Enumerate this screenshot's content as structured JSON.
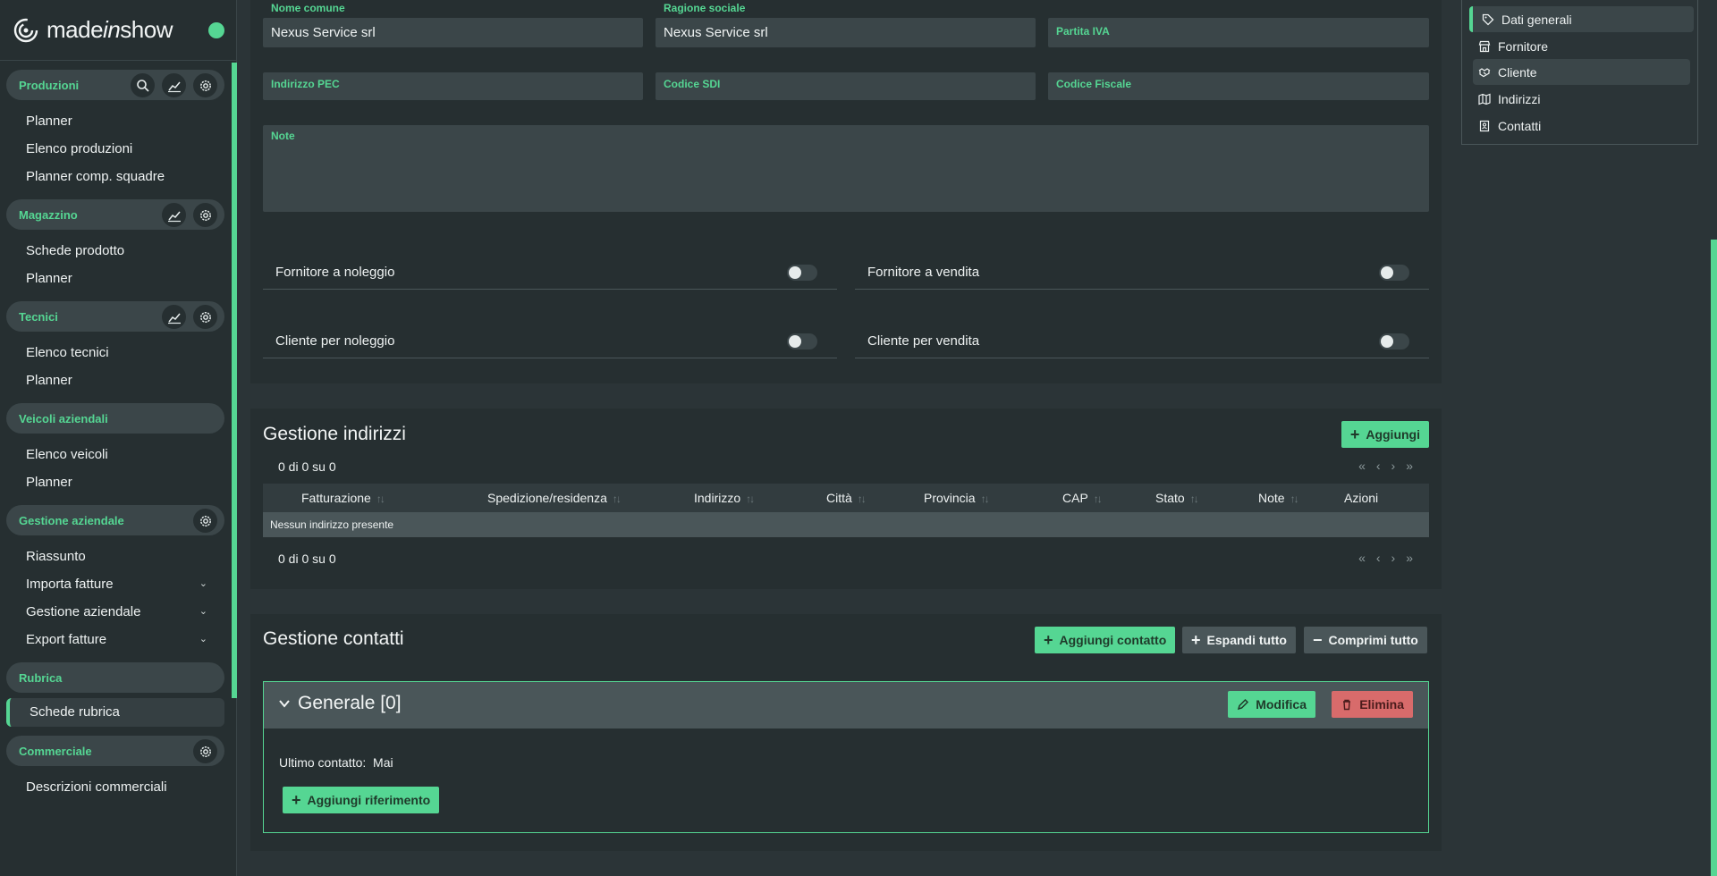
{
  "app": {
    "logo_pre": "made",
    "logo_italic": "in",
    "logo_post": "show"
  },
  "colors": {
    "accent": "#55d693",
    "danger": "#d86b6b",
    "panel": "#262f31",
    "field": "#3b4649"
  },
  "sidebar": {
    "sections": [
      {
        "title": "Produzioni",
        "icons": [
          "search-icon",
          "chart-icon",
          "gear-icon"
        ],
        "items": [
          {
            "label": "Planner"
          },
          {
            "label": "Elenco produzioni"
          },
          {
            "label": "Planner comp. squadre"
          }
        ]
      },
      {
        "title": "Magazzino",
        "icons": [
          "chart-icon",
          "gear-icon"
        ],
        "items": [
          {
            "label": "Schede prodotto"
          },
          {
            "label": "Planner"
          }
        ]
      },
      {
        "title": "Tecnici",
        "icons": [
          "chart-icon",
          "gear-icon"
        ],
        "items": [
          {
            "label": "Elenco tecnici"
          },
          {
            "label": "Planner"
          }
        ]
      },
      {
        "title": "Veicoli aziendali",
        "icons": [],
        "items": [
          {
            "label": "Elenco veicoli"
          },
          {
            "label": "Planner"
          }
        ]
      },
      {
        "title": "Gestione aziendale",
        "icons": [
          "gear-icon"
        ],
        "items": [
          {
            "label": "Riassunto"
          },
          {
            "label": "Importa fatture",
            "chevron": "⌄"
          },
          {
            "label": "Gestione aziendale",
            "chevron": "⌄"
          },
          {
            "label": "Export fatture",
            "chevron": "⌄"
          }
        ]
      },
      {
        "title": "Rubrica",
        "icons": [],
        "items": [
          {
            "label": "Schede rubrica",
            "active": true
          }
        ]
      },
      {
        "title": "Commerciale",
        "icons": [
          "gear-icon"
        ],
        "items": [
          {
            "label": "Descrizioni commerciali"
          }
        ]
      }
    ]
  },
  "form": {
    "nome_comune": {
      "label": "Nome comune",
      "value": "Nexus Service srl"
    },
    "ragione_sociale": {
      "label": "Ragione sociale",
      "value": "Nexus Service srl"
    },
    "partita_iva": {
      "label": "Partita IVA",
      "value": ""
    },
    "indirizzo_pec": {
      "label": "Indirizzo PEC",
      "value": ""
    },
    "codice_sdi": {
      "label": "Codice SDI",
      "value": ""
    },
    "codice_fiscale": {
      "label": "Codice Fiscale",
      "value": ""
    },
    "note": {
      "label": "Note",
      "value": ""
    },
    "toggles": {
      "fornitore_noleggio": {
        "label": "Fornitore a noleggio",
        "on": false
      },
      "fornitore_vendita": {
        "label": "Fornitore a vendita",
        "on": false
      },
      "cliente_noleggio": {
        "label": "Cliente per noleggio",
        "on": false
      },
      "cliente_vendita": {
        "label": "Cliente per vendita",
        "on": false
      }
    }
  },
  "indirizzi": {
    "title": "Gestione indirizzi",
    "add_label": "Aggiungi",
    "pager_top": "0 di 0 su 0",
    "pager_bottom": "0 di 0 su 0",
    "columns": [
      "Fatturazione",
      "Spedizione/residenza",
      "Indirizzo",
      "Città",
      "Provincia",
      "CAP",
      "Stato",
      "Note",
      "Azioni"
    ],
    "empty_text": "Nessun indirizzo presente"
  },
  "contatti": {
    "title": "Gestione contatti",
    "add_label": "Aggiungi contatto",
    "expand_label": "Espandi tutto",
    "collapse_label": "Comprimi tutto",
    "group": {
      "title": "Generale [0]",
      "edit_label": "Modifica",
      "delete_label": "Elimina",
      "last_contact_label": "Ultimo contatto:",
      "last_contact_value": "Mai",
      "add_ref_label": "Aggiungi riferimento"
    }
  },
  "right_nav": {
    "items": [
      {
        "label": "Dati generali",
        "icon": "tag-icon"
      },
      {
        "label": "Fornitore",
        "icon": "store-icon"
      },
      {
        "label": "Cliente",
        "icon": "handshake-icon"
      },
      {
        "label": "Indirizzi",
        "icon": "map-icon"
      },
      {
        "label": "Contatti",
        "icon": "contact-card-icon"
      }
    ]
  }
}
